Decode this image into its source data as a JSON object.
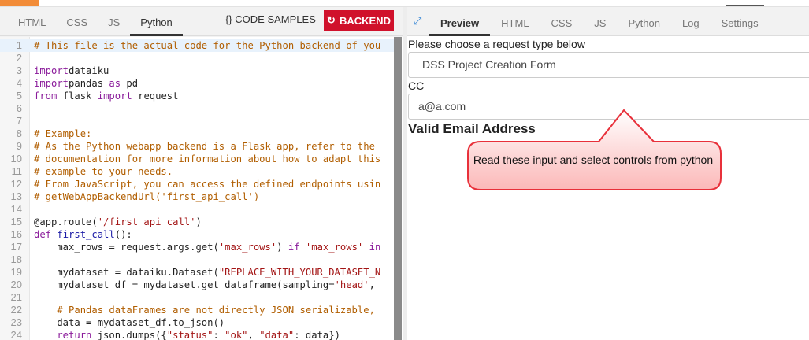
{
  "editor": {
    "tabs": [
      "HTML",
      "CSS",
      "JS",
      "Python"
    ],
    "active_tab": "Python",
    "code_samples_label": "{} CODE SAMPLES",
    "backend_label": "BACKEND",
    "lines": [
      [
        [
          "c",
          "# This file is the actual code for the Python backend of you"
        ]
      ],
      [],
      [
        [
          "k",
          "import"
        ],
        [
          "",
          "dataiku"
        ]
      ],
      [
        [
          "k",
          "import"
        ],
        [
          "",
          "pandas "
        ],
        [
          "k",
          "as"
        ],
        [
          "",
          " pd"
        ]
      ],
      [
        [
          "k",
          "from"
        ],
        [
          "",
          " flask "
        ],
        [
          "k",
          "import"
        ],
        [
          "",
          " request"
        ]
      ],
      [],
      [],
      [
        [
          "c",
          "# Example:"
        ]
      ],
      [
        [
          "c",
          "# As the Python webapp backend is a Flask app, refer to the"
        ]
      ],
      [
        [
          "c",
          "# documentation for more information about how to adapt this"
        ]
      ],
      [
        [
          "c",
          "# example to your needs."
        ]
      ],
      [
        [
          "c",
          "# From JavaScript, you can access the defined endpoints usin"
        ]
      ],
      [
        [
          "c",
          "# getWebAppBackendUrl('first_api_call')"
        ]
      ],
      [],
      [
        [
          "",
          "@app.route("
        ],
        [
          "s",
          "'/first_api_call'"
        ],
        [
          "",
          ")"
        ]
      ],
      [
        [
          "k",
          "def"
        ],
        [
          "f",
          " first_call"
        ],
        [
          "",
          "():"
        ]
      ],
      [
        [
          "",
          "    max_rows = request.args.get("
        ],
        [
          "s",
          "'max_rows'"
        ],
        [
          "",
          ") "
        ],
        [
          "k",
          "if"
        ],
        [
          "s",
          " 'max_rows'"
        ],
        [
          "k",
          " in"
        ]
      ],
      [],
      [
        [
          "",
          "    mydataset = dataiku.Dataset("
        ],
        [
          "s",
          "\"REPLACE_WITH_YOUR_DATASET_N"
        ]
      ],
      [
        [
          "",
          "    mydataset_df = mydataset.get_dataframe(sampling="
        ],
        [
          "s",
          "'head'"
        ],
        [
          "",
          ", "
        ]
      ],
      [],
      [
        [
          "c",
          "    # Pandas dataFrames are not directly JSON serializable,"
        ]
      ],
      [
        [
          "",
          "    data = mydataset_df.to_json()"
        ]
      ],
      [
        [
          "k",
          "    return"
        ],
        [
          "",
          " json.dumps({"
        ],
        [
          "s",
          "\"status\""
        ],
        [
          "",
          ": "
        ],
        [
          "s",
          "\"ok\""
        ],
        [
          "",
          ", "
        ],
        [
          "s",
          "\"data\""
        ],
        [
          "",
          ": data})"
        ]
      ]
    ]
  },
  "preview": {
    "tabs": [
      "Preview",
      "HTML",
      "CSS",
      "JS",
      "Python",
      "Log",
      "Settings"
    ],
    "active_tab": "Preview",
    "request_label": "Please choose a request type below",
    "request_value": "DSS Project Creation Form",
    "cc_label": "CC",
    "cc_value": "a@a.com",
    "validation": "Valid Email Address"
  },
  "callout": {
    "text": "Read these input and select controls from python"
  },
  "colors": {
    "accent": "#f28c38",
    "backend": "#d0112b"
  }
}
